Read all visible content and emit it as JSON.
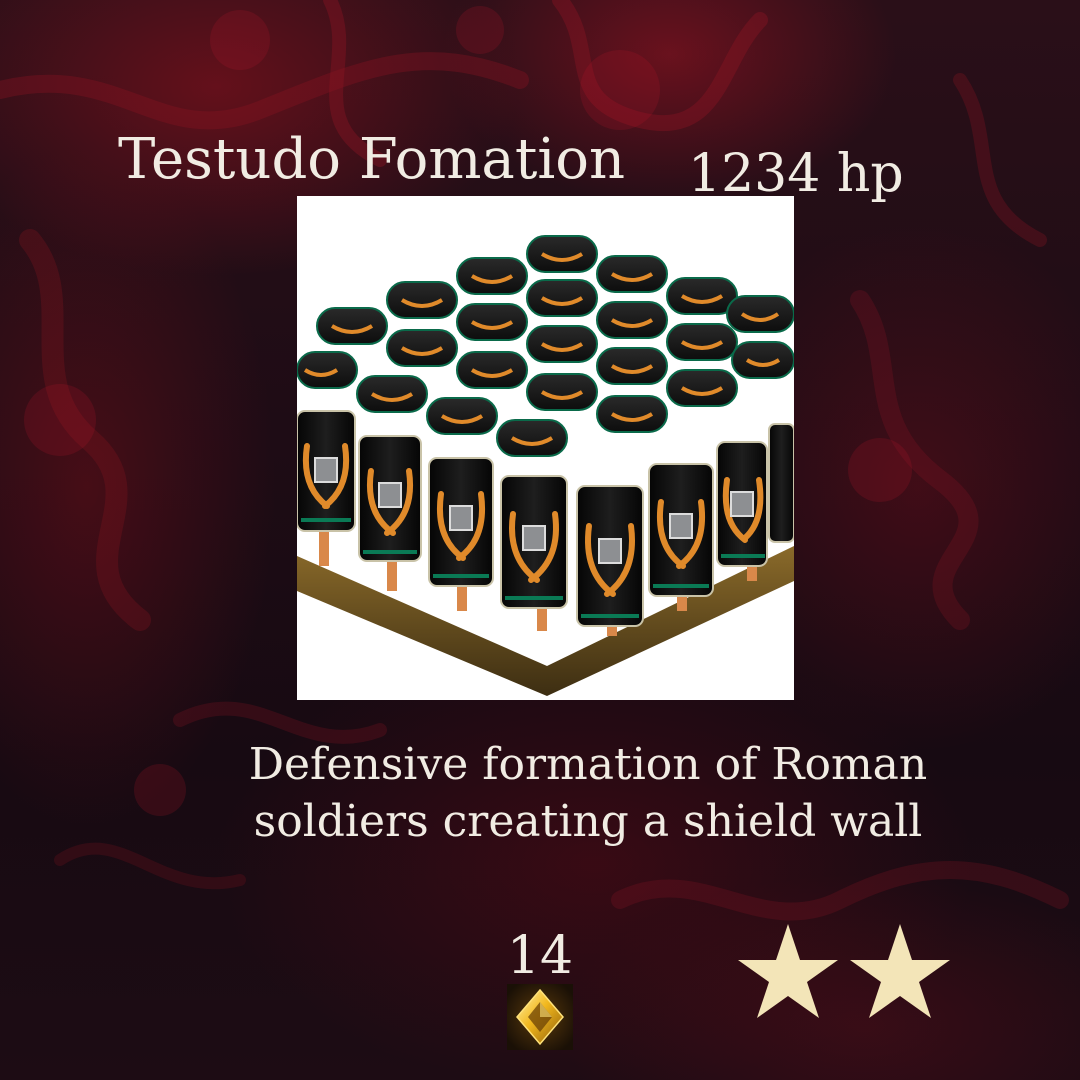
{
  "card": {
    "title": "Testudo Fomation",
    "hp": "1234 hp",
    "description_lines": [
      "Defensive formation of Roman",
      "soldiers creating a shield wall"
    ],
    "cost": "14",
    "cost_icon": "gold-diamond-gem-icon",
    "rarity_stars": 2,
    "colors": {
      "text": "#f1ece3",
      "star": "#f3e5b8",
      "shield": "#141414",
      "laurel": "#e08a2a",
      "background": "#1e0c15",
      "smoke": "#8c1422"
    }
  }
}
